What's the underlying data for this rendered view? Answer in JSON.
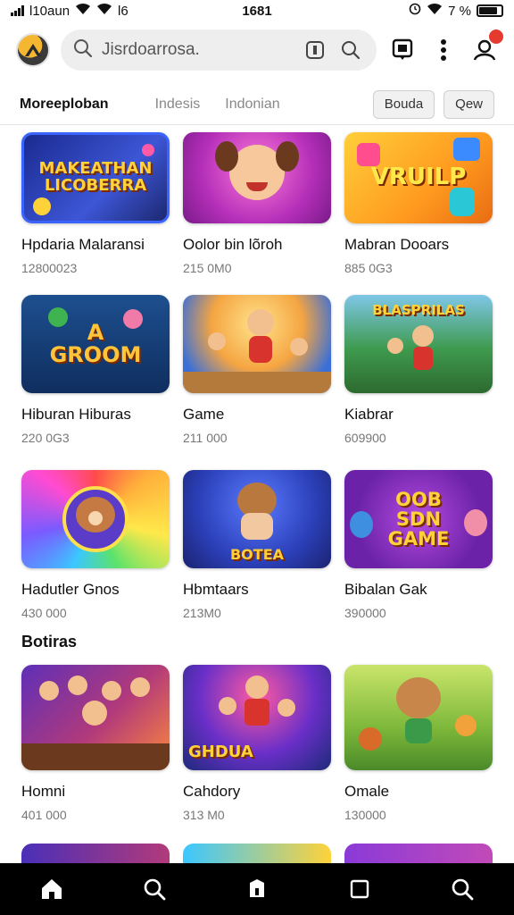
{
  "status": {
    "left_text": "l10aun",
    "extra": "l6",
    "time": "1681",
    "battery": "7 %"
  },
  "search": {
    "placeholder": "Jisrdoarrosa."
  },
  "tabs": {
    "items": [
      "Moreeploban",
      "Indesis",
      "Indonian"
    ],
    "buttons": [
      "Bouda",
      "Qew"
    ]
  },
  "grid": {
    "rows": [
      [
        {
          "title": "Hpdaria Malaransi",
          "sub": "1280​0023",
          "thumb_text": "MAKEATHAN\nLICOBERRA"
        },
        {
          "title": "Oolor bin lõroh",
          "sub": "215 0M0",
          "thumb_text": ""
        },
        {
          "title": "Mabran Dooars",
          "sub": "885 0​G3",
          "thumb_text": "VRUILP"
        }
      ],
      [
        {
          "title": "Hiburan Hiburas",
          "sub": "220 0​G3",
          "thumb_text": "A\nGROOM"
        },
        {
          "title": "Game",
          "sub": "211 0​00",
          "thumb_text": ""
        },
        {
          "title": "Kiabrar",
          "sub": "609900",
          "thumb_text": "BLASPRILAS"
        }
      ],
      [
        {
          "title": "Hadutler Gnos",
          "sub": "430 000",
          "thumb_text": ""
        },
        {
          "title": "Hbmtaars",
          "sub": "213M0",
          "thumb_text": "BOTEA"
        },
        {
          "title": "Bibalan Gak",
          "sub": "390000",
          "thumb_text": "OOB\nSDN\nGAME"
        }
      ]
    ]
  },
  "section": {
    "title": "Botiras",
    "items": [
      {
        "title": "Homni",
        "sub": "401 000",
        "thumb_text": ""
      },
      {
        "title": "Cahdory",
        "sub": "313 M0",
        "thumb_text": "GHDUA"
      },
      {
        "title": "Omale",
        "sub": "130000",
        "thumb_text": ""
      }
    ]
  },
  "bottom_nav": [
    "home-icon",
    "search-icon",
    "games-icon",
    "square-icon",
    "search-icon"
  ],
  "colors": {
    "accent_red": "#e53a2f",
    "nav_bg": "#000000"
  }
}
